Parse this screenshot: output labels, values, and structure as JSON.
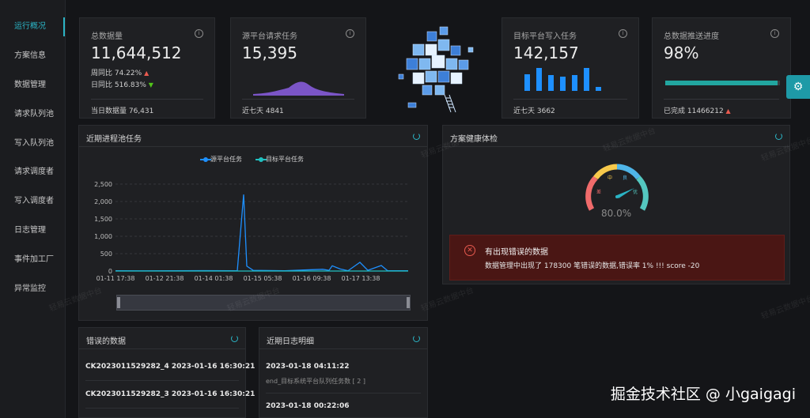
{
  "sidebar": {
    "items": [
      {
        "label": "运行概况",
        "active": true
      },
      {
        "label": "方案信息"
      },
      {
        "label": "数据管理"
      },
      {
        "label": "请求队列池"
      },
      {
        "label": "写入队列池"
      },
      {
        "label": "请求调度者"
      },
      {
        "label": "写入调度者"
      },
      {
        "label": "日志管理"
      },
      {
        "label": "事件加工厂"
      },
      {
        "label": "异常监控"
      }
    ]
  },
  "stats": {
    "total": {
      "title": "总数据量",
      "value": "11,644,512",
      "wow_label": "周同比 74.22%",
      "dod_label": "日同比 516.83%",
      "foot": "当日数据量  76,431"
    },
    "source": {
      "title": "源平台请求任务",
      "value": "15,395",
      "foot": "近七天  4841"
    },
    "target": {
      "title": "目标平台写入任务",
      "value": "142,157",
      "foot": "近七天  3662",
      "bars": [
        0.7,
        0.95,
        0.65,
        0.6,
        0.65,
        0.95,
        0.15
      ]
    },
    "progress": {
      "title": "总数据推送进度",
      "value": "98%",
      "percent": 98,
      "foot": "已完成 11466212"
    }
  },
  "pool_chart": {
    "title": "近期进程池任务",
    "legend": [
      "源平台任务",
      "目标平台任务"
    ],
    "colors": [
      "#1e90ff",
      "#20c0c0"
    ]
  },
  "chart_data": {
    "type": "line",
    "x": [
      "01-11 17:38",
      "01-12 21:38",
      "01-14 01:38",
      "01-15 05:38",
      "01-16 09:38",
      "01-17 13:38"
    ],
    "series": [
      {
        "name": "源平台任务",
        "values": [
          10,
          5,
          8,
          12,
          6,
          2200,
          140,
          20,
          10,
          50,
          20,
          150,
          60,
          10,
          250,
          20,
          160,
          10,
          8
        ]
      },
      {
        "name": "目标平台任务",
        "values": [
          0,
          0,
          0,
          0,
          0,
          0,
          0,
          0,
          0,
          0,
          0,
          0,
          0,
          0,
          0,
          0,
          0,
          0,
          0
        ]
      }
    ],
    "yticks": [
      "0",
      "500",
      "1,000",
      "1,500",
      "2,000",
      "2,500"
    ],
    "ylim": [
      0,
      2500
    ]
  },
  "health": {
    "title": "方案健康体检",
    "gauge_value": "80.0%",
    "gauge_percent": 80,
    "gauge_labels": {
      "poor": "差",
      "mid": "中",
      "good": "良",
      "excellent": "优"
    },
    "error_title": "有出现错误的数据",
    "error_message": "数据管理中出现了 178300 笔错误的数据,错误率 1% !!! score -20"
  },
  "error_data": {
    "title": "错误的数据",
    "items": [
      "CK2023011529282_4 2023-01-16 16:30:21",
      "CK2023011529282_3 2023-01-16 16:30:21"
    ]
  },
  "logs": {
    "title": "近期日志明细",
    "items": [
      {
        "time": "2023-01-18 04:11:22",
        "text": "end_目标系统平台队列任务数 [ 2 ]"
      },
      {
        "time": "2023-01-18 00:22:06"
      }
    ]
  },
  "watermark": "轻易云数据中台",
  "credit": "掘金技术社区 @ 小gaigagi"
}
